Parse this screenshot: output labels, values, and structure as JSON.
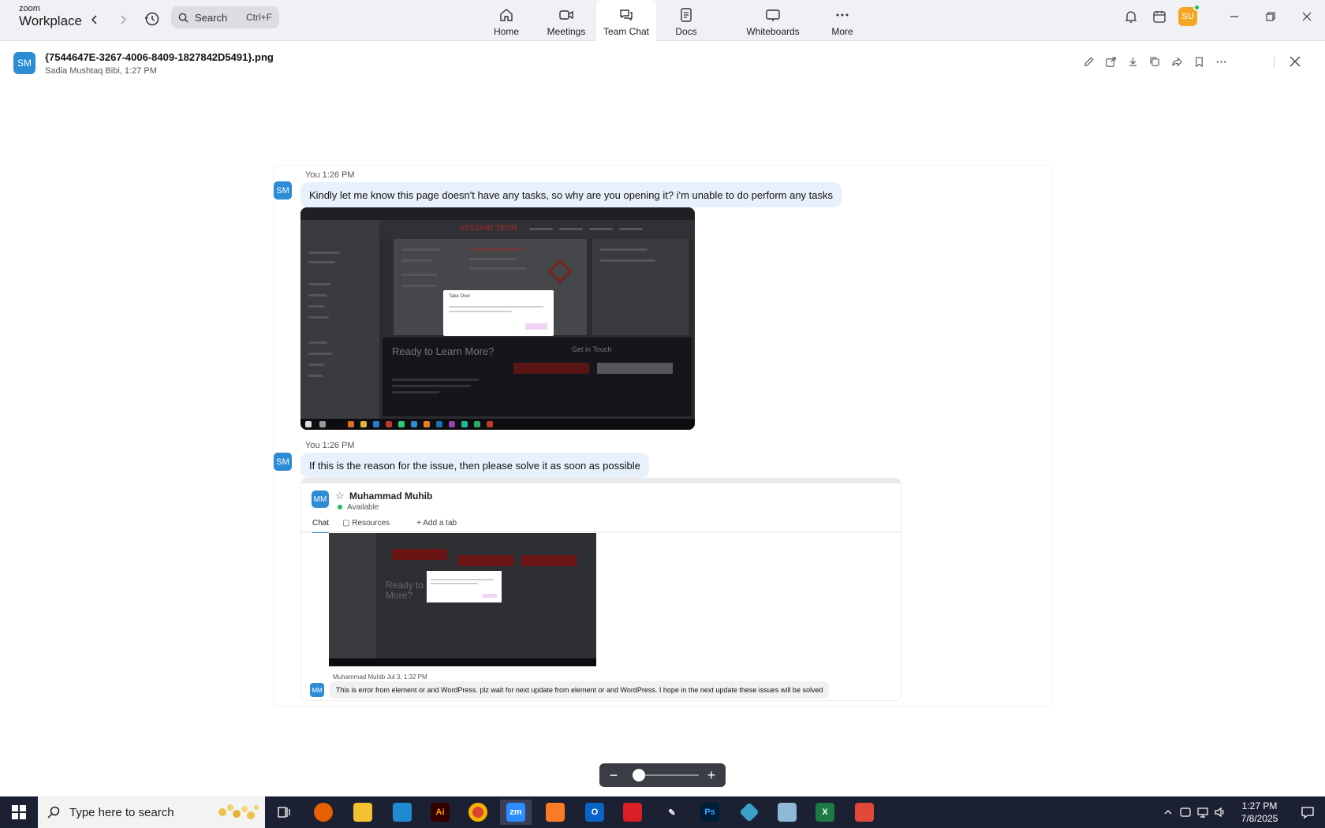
{
  "app": {
    "logo_small": "zoom",
    "logo_big": "Workplace",
    "search_placeholder": "Search",
    "search_shortcut": "Ctrl+F"
  },
  "tabs": [
    {
      "label": "Home",
      "icon": "home-icon"
    },
    {
      "label": "Meetings",
      "icon": "video-icon"
    },
    {
      "label": "Team Chat",
      "icon": "chat-icon",
      "active": true
    },
    {
      "label": "Docs",
      "icon": "doc-icon"
    },
    {
      "label": "Whiteboards",
      "icon": "whiteboard-icon"
    },
    {
      "label": "More",
      "icon": "more-icon"
    }
  ],
  "user": {
    "initials": "SU",
    "color": "#f5a623"
  },
  "file": {
    "name": "{7544647E-3267-4006-8409-1827842D5491}.png",
    "meta": "Sadia Mushtaq Bibi, 1:27 PM",
    "avatar": "SM"
  },
  "preview": {
    "messages": [
      {
        "meta": "You 1:26 PM",
        "avatar": "SM",
        "text": "Kindly let me know this page doesn't have any tasks, so why are you opening it? i'm unable to do perform any tasks"
      },
      {
        "meta": "You 1:26 PM",
        "avatar": "SM",
        "text": "If this is the reason for the issue, then please solve it as soon as possible"
      }
    ],
    "shot1": {
      "brand": "VCLOUD TECH",
      "ready": "Ready to Learn More?",
      "get_in_touch": "Get in Touch",
      "dialog_title": "Take Over"
    },
    "shot2": {
      "avatar": "MM",
      "name": "Muhammad Muhib",
      "status": "Available",
      "tab_chat": "Chat",
      "tab_resources": "Resources",
      "tab_add": "Add a tab",
      "reply_meta": "Muhammad Muhib Jul 3, 1:32 PM",
      "reply_avatar": "MM",
      "reply_text": "This is error from element or and WordPress. plz wait for next update from element or and WordPress. I hope in the next update these issues will be solved"
    }
  },
  "zoom_control": {
    "minus": "−",
    "plus": "+",
    "level": 0.1
  },
  "taskbar": {
    "search_placeholder": "Type here to search",
    "time": "1:27 PM",
    "date": "7/8/2025"
  }
}
